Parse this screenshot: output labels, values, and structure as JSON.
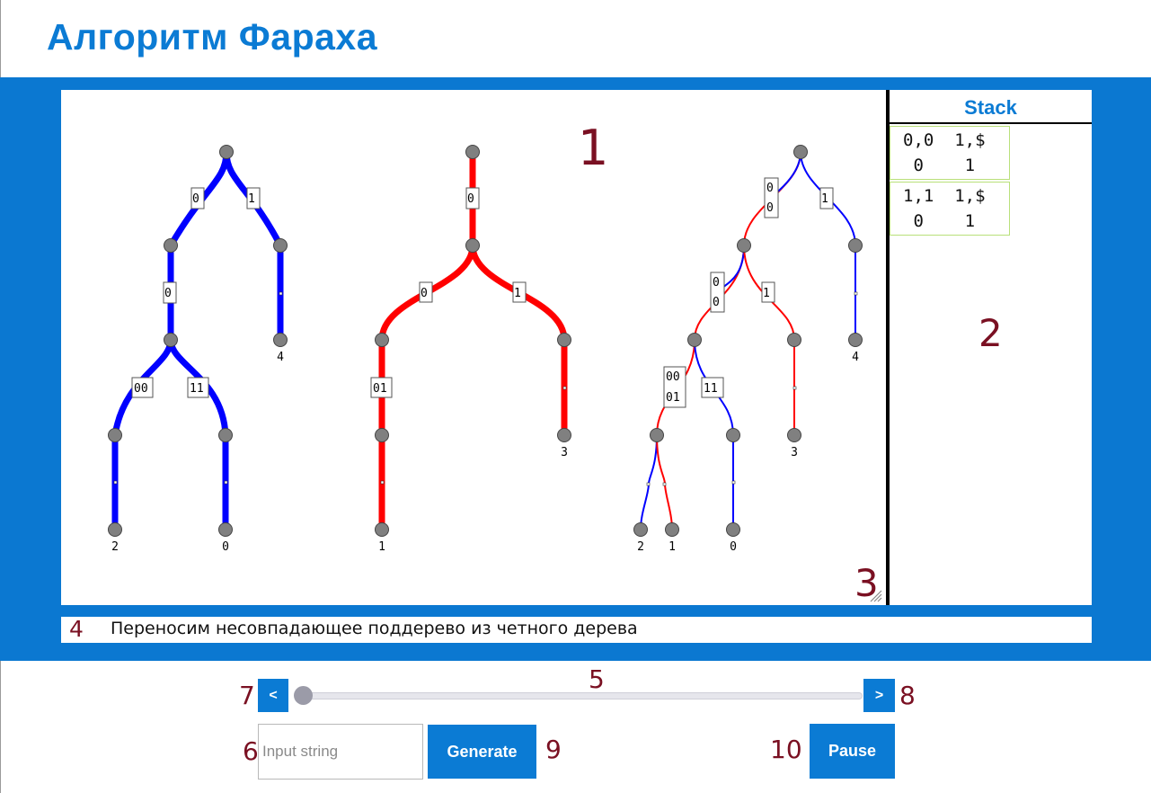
{
  "app": {
    "title": "Алгоритм Фараха"
  },
  "markers": {
    "m1": "1",
    "m2": "2",
    "m3": "3",
    "m4": "4",
    "m5": "5",
    "m6": "6",
    "m7": "7",
    "m8": "8",
    "m9": "9",
    "m10": "10"
  },
  "stack": {
    "title": "Stack",
    "items": [
      {
        "line1": "0,0  1,$",
        "line2": " 0    1"
      },
      {
        "line1": "1,1  1,$",
        "line2": " 0    1"
      }
    ]
  },
  "status": {
    "text": "Переносим несовпадающее поддерево из четного дерева"
  },
  "controls": {
    "prev_label": "<",
    "next_label": ">",
    "slider_position": 0,
    "input_placeholder": "Input string",
    "input_value": "",
    "generate_label": "Generate",
    "pause_label": "Pause"
  },
  "colors": {
    "accent": "#0b78d1",
    "tree_blue": "#0000ff",
    "tree_red": "#ff0000",
    "node": "#808080",
    "marker": "#7a1022"
  },
  "trees": {
    "blue_tree": {
      "edge_labels": [
        "0",
        "1",
        "0",
        "00",
        "11"
      ],
      "leaf_labels": [
        "4",
        "2",
        "0"
      ]
    },
    "red_tree": {
      "edge_labels": [
        "0",
        "0",
        "1",
        "01"
      ],
      "leaf_labels": [
        "3",
        "1"
      ]
    },
    "merged_tree": {
      "edge_labels": [
        "0",
        "0",
        "1",
        "0",
        "0",
        "1",
        "00",
        "01",
        "11"
      ],
      "leaf_labels": [
        "4",
        "3",
        "2",
        "1",
        "0"
      ]
    }
  }
}
